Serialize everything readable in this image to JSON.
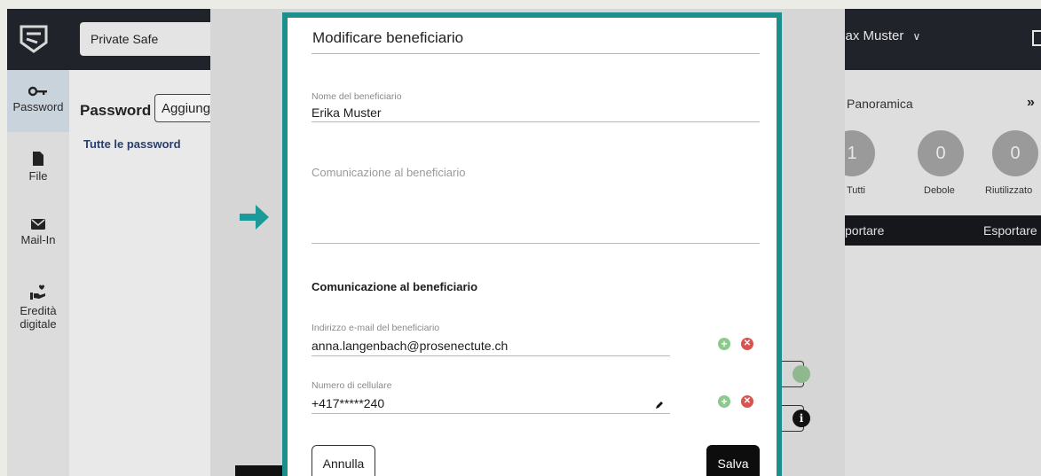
{
  "header": {
    "vault_name": "Private Safe",
    "user_name": "Max Muster"
  },
  "sidebar": {
    "items": [
      {
        "label": "Password",
        "icon": "key-icon",
        "active": true
      },
      {
        "label": "File",
        "icon": "file-icon",
        "active": false
      },
      {
        "label": "Mail-In",
        "icon": "mail-icon",
        "active": false
      },
      {
        "label_line1": "Eredità",
        "label_line2": "digitale",
        "icon": "heart-hand-icon",
        "active": false
      }
    ]
  },
  "main": {
    "title": "Password",
    "add_button": "Aggiungi",
    "filter_label": "Tutte le password"
  },
  "overview": {
    "title": "Panoramica",
    "counters": [
      {
        "label": "Tutti",
        "value": "1"
      },
      {
        "label": "Debole",
        "value": "0"
      },
      {
        "label": "Riutilizzato",
        "value": "0"
      }
    ],
    "export_left": "portare",
    "export_right": "Esportare"
  },
  "modal": {
    "title": "Modificare beneficiario",
    "name_label": "Nome del beneficiario",
    "name_value": "Erika Muster",
    "message_placeholder": "Comunicazione al beneficiario",
    "section_title": "Comunicazione al beneficiario",
    "email_label": "Indirizzo e-mail del beneficiario",
    "email_value": "anna.langenbach@prosenectute.ch",
    "phone_label": "Numero di cellulare",
    "phone_value": "+417*****240",
    "cancel_label": "Annulla",
    "save_label": "Salva"
  },
  "colors": {
    "accent": "#1c8e8e",
    "topbar": "#20232a",
    "add": "#8cc98c",
    "remove": "#d9544f"
  }
}
